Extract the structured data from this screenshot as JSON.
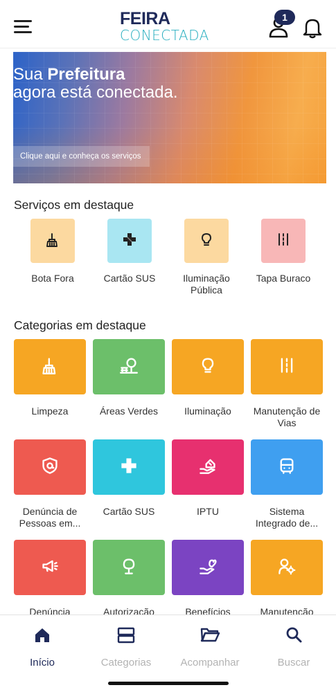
{
  "header": {
    "logo_line1": "FEIRA",
    "logo_line2": "CONECTADA",
    "notification_count": "1"
  },
  "banner": {
    "title_pre": "Sua ",
    "title_bold": "Prefeitura",
    "title_rest": "agora está conectada.",
    "cta": "Clique aqui e conheça os serviços"
  },
  "featured_services": {
    "title": "Serviços em destaque",
    "items": [
      {
        "label": "Bota Fora",
        "icon": "broom-icon",
        "bg": "#fcd9a0"
      },
      {
        "label": "Cartão SUS",
        "icon": "medical-cross-icon",
        "bg": "#a9e6f2"
      },
      {
        "label": "Iluminação Pública",
        "icon": "lightbulb-icon",
        "bg": "#fcd9a0"
      },
      {
        "label": "Tapa Buraco",
        "icon": "road-icon",
        "bg": "#f8b7b7"
      }
    ]
  },
  "featured_categories": {
    "title": "Categorias em destaque",
    "items": [
      {
        "label": "Limpeza",
        "icon": "broom-icon",
        "bg": "#f6a623"
      },
      {
        "label": "Áreas Verdes",
        "icon": "tree-bench-icon",
        "bg": "#6cbf6a"
      },
      {
        "label": "Iluminação",
        "icon": "lightbulb-icon",
        "bg": "#f6a623"
      },
      {
        "label": "Manutenção de Vias",
        "icon": "road-icon",
        "bg": "#f6a623"
      },
      {
        "label": "Denúncia de Pessoas em...",
        "icon": "shield-at-icon",
        "bg": "#ee5a50"
      },
      {
        "label": "Cartão SUS",
        "icon": "medical-cross-icon",
        "bg": "#2fc6dd"
      },
      {
        "label": "IPTU",
        "icon": "house-hand-icon",
        "bg": "#e7306f"
      },
      {
        "label": "Sistema Integrado de...",
        "icon": "bus-icon",
        "bg": "#3f9ff0"
      },
      {
        "label": "Denúncia",
        "icon": "megaphone-icon",
        "bg": "#ee5a50"
      },
      {
        "label": "Autorização",
        "icon": "tree-icon",
        "bg": "#6cbf6a"
      },
      {
        "label": "Benefícios",
        "icon": "heart-hand-icon",
        "bg": "#7b44c2"
      },
      {
        "label": "Manutenção",
        "icon": "user-gear-icon",
        "bg": "#f6a623"
      }
    ]
  },
  "bottom_nav": {
    "items": [
      {
        "label": "Início",
        "icon": "home-icon",
        "active": true
      },
      {
        "label": "Categorias",
        "icon": "categories-icon",
        "active": false
      },
      {
        "label": "Acompanhar",
        "icon": "folder-icon",
        "active": false
      },
      {
        "label": "Buscar",
        "icon": "search-icon",
        "active": false
      }
    ]
  },
  "colors": {
    "brand_dark": "#1f2a5a",
    "brand_teal": "#27aebf",
    "inactive": "#b3b3b3"
  }
}
